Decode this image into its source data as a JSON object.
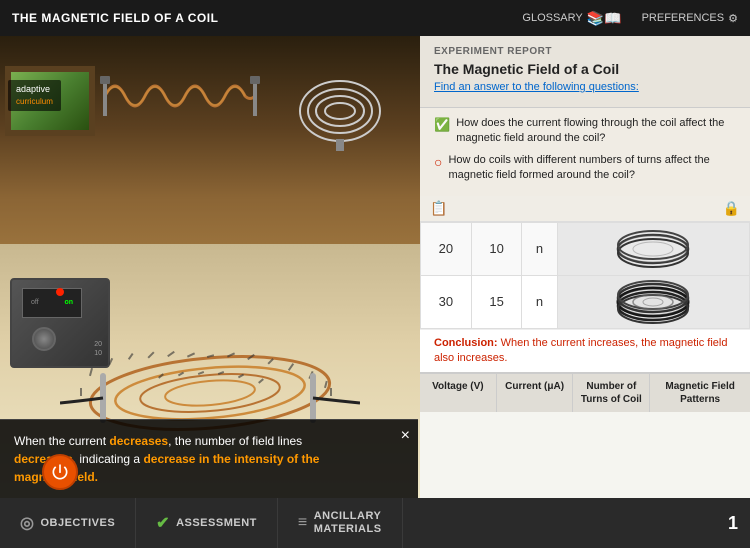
{
  "topBar": {
    "title": "THE MAGNETIC FIELD OF A COIL",
    "glossary": "GLOSSARY",
    "preferences": "PREFERENCES"
  },
  "logo": {
    "line1": "adaptive",
    "line2": "curriculum"
  },
  "infoBox": {
    "text1": "When the current ",
    "word1": "decreases",
    "text2": ", the number of field lines",
    "word2": "decreases",
    "text3": ", indicating a ",
    "word3": "decrease in the intensity of the magnetic field.",
    "word3_plain": "decrease in the intensity of the",
    "word3_end": "magnetic field."
  },
  "report": {
    "sectionLabel": "EXPERIMENT REPORT",
    "title": "The Magnetic Field of a Coil",
    "subtitle": "Find an answer to the following questions:",
    "questions": [
      {
        "icon": "✅",
        "text": "How does the current flowing through the coil affect the magnetic field around the coil?"
      },
      {
        "icon": "○",
        "text": "How do coils with different numbers of turns affect the magnetic field formed around the coil?"
      }
    ]
  },
  "table": {
    "rows": [
      {
        "voltage": "20",
        "current": "10",
        "turns": "n"
      },
      {
        "voltage": "30",
        "current": "15",
        "turns": "n"
      }
    ],
    "headers": {
      "voltage": "Voltage (V)",
      "current": "Current (μA)",
      "turns": "Number of Turns of Coil",
      "patterns": "Magnetic Field Patterns"
    }
  },
  "conclusion": {
    "label": "Conclusion:",
    "text": " When the current increases, the magnetic field also increases."
  },
  "bottomNav": {
    "objectives": "OBJECTIVES",
    "assessment": "ASSESSMENT",
    "ancillary": "ANCILLARY",
    "materials": "MATERIALS",
    "pageNum": "1"
  }
}
